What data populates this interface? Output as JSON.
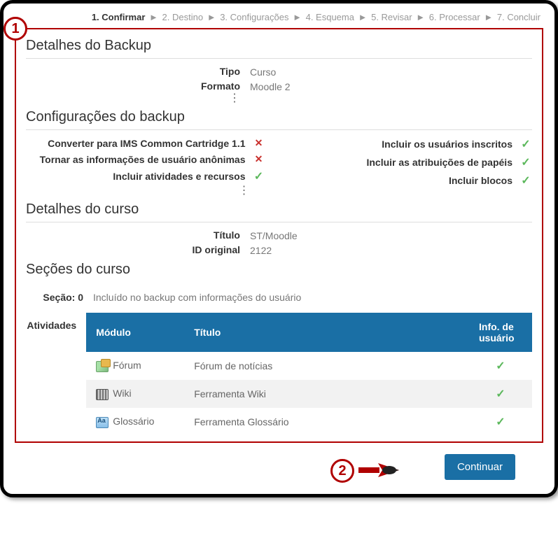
{
  "breadcrumb": {
    "steps": [
      "1. Confirmar",
      "2. Destino",
      "3. Configurações",
      "4. Esquema",
      "5. Revisar",
      "6. Processar",
      "7. Concluir"
    ],
    "active_index": 0,
    "separator": "►"
  },
  "callouts": {
    "one": "1",
    "two": "2"
  },
  "details": {
    "title": "Detalhes do Backup",
    "type_label": "Tipo",
    "type_value": "Curso",
    "format_label": "Formato",
    "format_value": "Moodle 2"
  },
  "settings": {
    "title": "Configurações do backup",
    "left": [
      {
        "label": "Converter para IMS Common Cartridge 1.1",
        "state": "cross"
      },
      {
        "label": "Tornar as informações de usuário anônimas",
        "state": "cross"
      },
      {
        "label": "Incluir atividades e recursos",
        "state": "check"
      }
    ],
    "right": [
      {
        "label": "Incluir os usuários inscritos",
        "state": "check"
      },
      {
        "label": "Incluir as atribuições de papéis",
        "state": "check"
      },
      {
        "label": "Incluir blocos",
        "state": "check"
      }
    ]
  },
  "course": {
    "title": "Detalhes do curso",
    "name_label": "Título",
    "name_value": "ST/Moodle",
    "id_label": "ID original",
    "id_value": "2122"
  },
  "sections": {
    "title": "Seções do curso",
    "section_label": "Seção: 0",
    "section_note": "Incluído no backup com informações do usuário"
  },
  "activities": {
    "label": "Atividades",
    "headers": {
      "module": "Módulo",
      "title": "Título",
      "userinfo": "Info. de usuário"
    },
    "rows": [
      {
        "icon": "forum",
        "module": "Fórum",
        "title": "Fórum de notícias",
        "userinfo": "check"
      },
      {
        "icon": "wiki",
        "module": "Wiki",
        "title": "Ferramenta Wiki",
        "userinfo": "check"
      },
      {
        "icon": "gloss",
        "module": "Glossário",
        "title": "Ferramenta Glossário",
        "userinfo": "check"
      }
    ]
  },
  "footer": {
    "continue": "Continuar"
  },
  "marks": {
    "cross": "✕",
    "check": "✓"
  }
}
